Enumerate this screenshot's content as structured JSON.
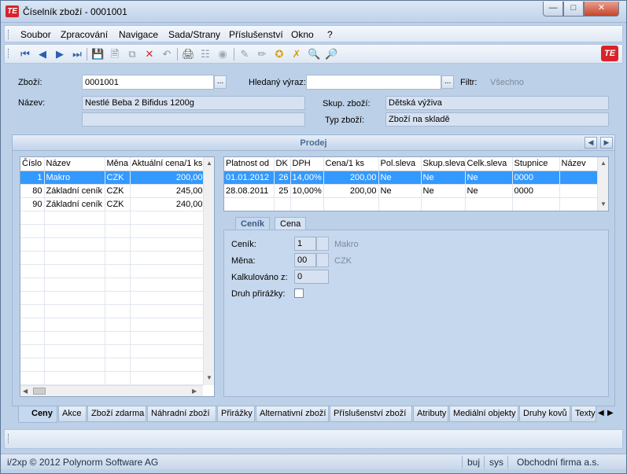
{
  "window": {
    "title": "Číselník zboží - 0001001",
    "logo": "TE"
  },
  "menu": [
    "Soubor",
    "Zpracování",
    "Navigace",
    "Sada/Strany",
    "Příslušenství",
    "Okno",
    "?"
  ],
  "form": {
    "zbozi_label": "Zboží:",
    "zbozi_value": "0001001",
    "hledany_label": "Hledaný výraz:",
    "hledany_value": "",
    "filtr_label": "Filtr:",
    "filtr_value": "Všechno",
    "nazev_label": "Název:",
    "nazev_value": "Nestlé Beba 2 Bifidus 1200g",
    "nazev2_value": "",
    "skup_label": "Skup. zboží:",
    "skup_value": "Dětská výživa",
    "typ_label": "Typ zboží:",
    "typ_value": "Zboží na skladě",
    "ellipsis": "..."
  },
  "section": {
    "title": "Prodej"
  },
  "left_grid": {
    "headers": [
      "Číslo",
      "Název",
      "Měna",
      "Aktuální cena/1 ks"
    ],
    "rows": [
      [
        "1",
        "Makro",
        "CZK",
        "200,00"
      ],
      [
        "80",
        "Základní ceník",
        "CZK",
        "245,00"
      ],
      [
        "90",
        "Základní ceník",
        "CZK",
        "240,00"
      ]
    ]
  },
  "right_grid": {
    "headers": [
      "Platnost od",
      "DK",
      "DPH",
      "Cena/1 ks",
      "Pol.sleva",
      "Skup.sleva",
      "Celk.sleva",
      "Stupnice",
      "Název"
    ],
    "rows": [
      [
        "01.01.2012",
        "26",
        "14,00%",
        "200,00",
        "Ne",
        "Ne",
        "Ne",
        "0000",
        ""
      ],
      [
        "28.08.2011",
        "25",
        "10,00%",
        "200,00",
        "Ne",
        "Ne",
        "Ne",
        "0000",
        ""
      ]
    ]
  },
  "subtabs": [
    "Ceník",
    "Cena"
  ],
  "cenik": {
    "cenik_label": "Ceník:",
    "cenik_value": "1",
    "cenik_name": "Makro",
    "mena_label": "Měna:",
    "mena_value": "00",
    "mena_name": "CZK",
    "kalk_label": "Kalkulováno z:",
    "kalk_value": "0",
    "druh_label": "Druh přirážky:"
  },
  "bottom_tabs": [
    "Ceny",
    "Akce",
    "Zboží zdarma",
    "Náhradní zboží",
    "Přirážky",
    "Alternativní zboží",
    "Příslušenství zboží",
    "Atributy",
    "Mediální objekty",
    "Druhy kovů",
    "Texty"
  ],
  "status": {
    "copyright": "i/2xp © 2012 Polynorm Software AG",
    "user": "buj",
    "db": "sys",
    "company": "Obchodní firma a.s."
  }
}
